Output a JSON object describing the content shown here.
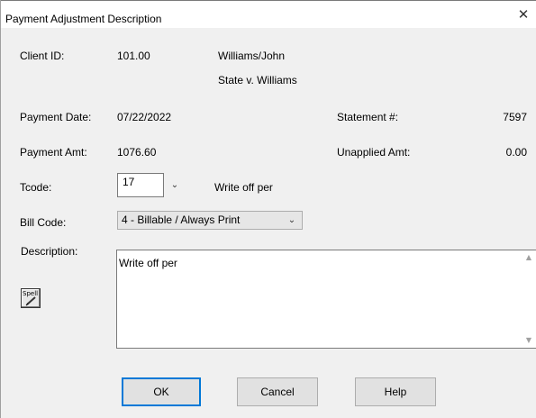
{
  "window": {
    "title": "Payment Adjustment Description",
    "close_glyph": "✕"
  },
  "client": {
    "label": "Client ID:",
    "id": "101.00",
    "name": "Williams/John",
    "matter": "State v. Williams"
  },
  "payment": {
    "date_label": "Payment Date:",
    "date": "07/22/2022",
    "amount_label": "Payment Amt:",
    "amount": "1076.60"
  },
  "statement": {
    "label": "Statement #:",
    "number": "7597",
    "unapplied_label": "Unapplied Amt:",
    "unapplied": "0.00"
  },
  "tcode": {
    "label": "Tcode:",
    "value": "17",
    "dropdown_glyph": "⌄",
    "description": "Write off per"
  },
  "bill_code": {
    "label": "Bill Code:",
    "selected": "4 - Billable / Always Print",
    "dropdown_glyph": "⌄"
  },
  "description": {
    "label": "Description:",
    "text": "Write off per",
    "scroll_up_glyph": "▲",
    "scroll_down_glyph": "▼"
  },
  "spell": {
    "label": "Spell",
    "icon": "spell-check-icon"
  },
  "buttons": {
    "ok": "OK",
    "cancel": "Cancel",
    "help": "Help"
  },
  "colors": {
    "default_button_border": "#0078d7",
    "dialog_background": "#f0f0f0"
  }
}
